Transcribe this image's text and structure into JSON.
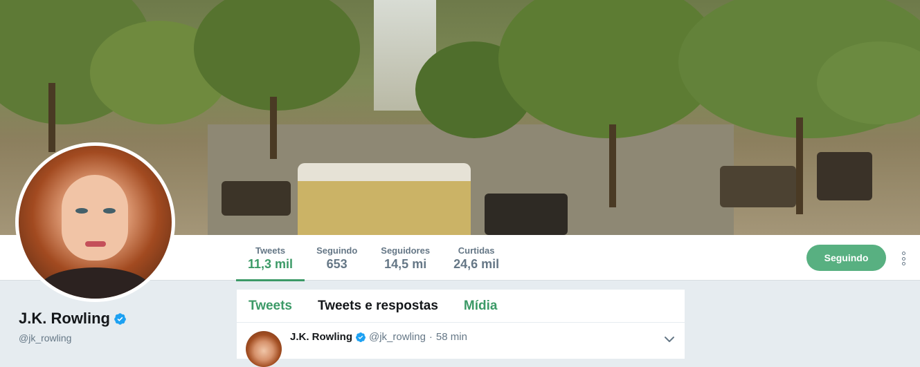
{
  "profile": {
    "name": "J.K. Rowling",
    "handle": "@jk_rowling"
  },
  "stats": [
    {
      "label": "Tweets",
      "value": "11,3 mil",
      "active": true
    },
    {
      "label": "Seguindo",
      "value": "653",
      "active": false
    },
    {
      "label": "Seguidores",
      "value": "14,5 mi",
      "active": false
    },
    {
      "label": "Curtidas",
      "value": "24,6 mil",
      "active": false
    }
  ],
  "actions": {
    "follow_label": "Seguindo",
    "more_icon": "more-vertical-icon"
  },
  "tabs": [
    {
      "label": "Tweets"
    },
    {
      "label": "Tweets e respostas"
    },
    {
      "label": "Mídia"
    }
  ],
  "tweet": {
    "author": "J.K. Rowling",
    "handle": "@jk_rowling",
    "separator": "·",
    "time": "58 min"
  },
  "colors": {
    "accent": "#3c9a67",
    "follow_button": "#58b081",
    "verified": "#1da1f2",
    "muted": "#657786"
  }
}
